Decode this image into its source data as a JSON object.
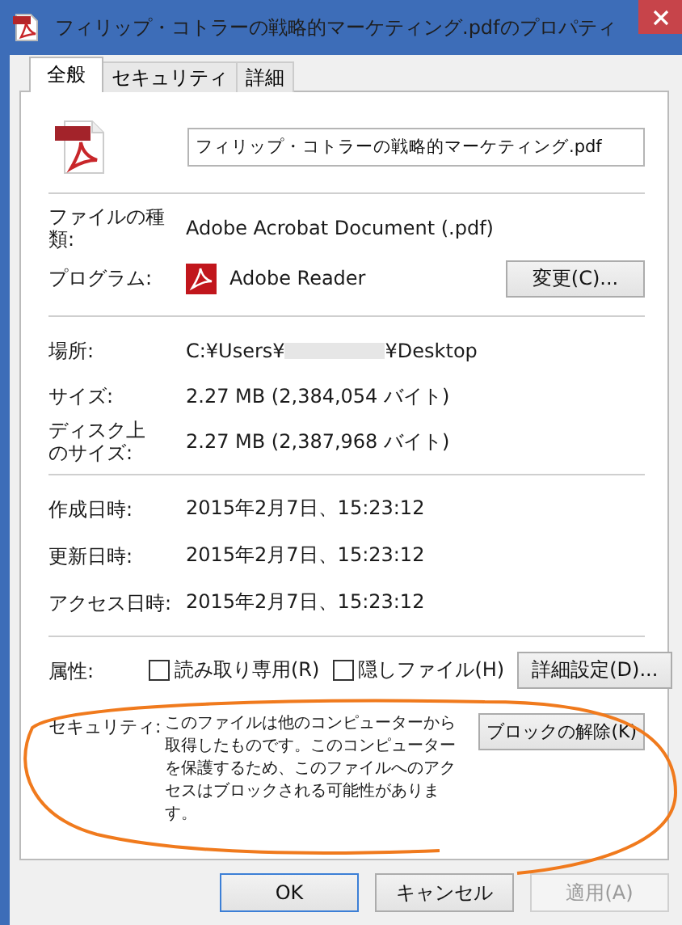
{
  "window": {
    "title": "フィリップ・コトラーの戦略的マーケティング.pdfのプロパティ"
  },
  "tabs": [
    {
      "label": "全般",
      "selected": true
    },
    {
      "label": "セキュリティ",
      "selected": false
    },
    {
      "label": "詳細",
      "selected": false
    }
  ],
  "file_name": "フィリップ・コトラーの戦略的マーケティング.pdf",
  "file_type": {
    "label": "ファイルの種類:",
    "value": "Adobe Acrobat Document (.pdf)"
  },
  "program": {
    "label": "プログラム:",
    "value": "Adobe Reader",
    "button": "変更(C)..."
  },
  "location": {
    "label": "場所:",
    "prefix": "C:¥Users¥",
    "suffix": "¥Desktop"
  },
  "sizes": [
    {
      "label_lines": [
        "サイズ:"
      ],
      "value": "2.27 MB (2,384,054 バイト)"
    },
    {
      "label_lines": [
        "ディスク上",
        "のサイズ:"
      ],
      "value": "2.27 MB (2,387,968 バイト)"
    }
  ],
  "dates": [
    {
      "label": "作成日時:",
      "value": "2015年2月7日、15:23:12"
    },
    {
      "label": "更新日時:",
      "value": "2015年2月7日、15:23:12"
    },
    {
      "label": "アクセス日時:",
      "value": "2015年2月7日、15:23:12"
    }
  ],
  "attributes": {
    "label": "属性:",
    "checkboxes": [
      {
        "label": "読み取り専用(R)",
        "checked": false
      },
      {
        "label": "隠しファイル(H)",
        "checked": false
      }
    ],
    "button": "詳細設定(D)..."
  },
  "security": {
    "label": "セキュリティ:",
    "text": "このファイルは他のコンピューターから取得したものです。このコンピューターを保護するため、このファイルへのアクセスはブロックされる可能性があります。",
    "button": "ブロックの解除(K)"
  },
  "buttons": [
    {
      "label": "OK",
      "default": true,
      "disabled": false
    },
    {
      "label": "キャンセル",
      "default": false,
      "disabled": false
    },
    {
      "label": "適用(A)",
      "default": false,
      "disabled": true
    }
  ]
}
